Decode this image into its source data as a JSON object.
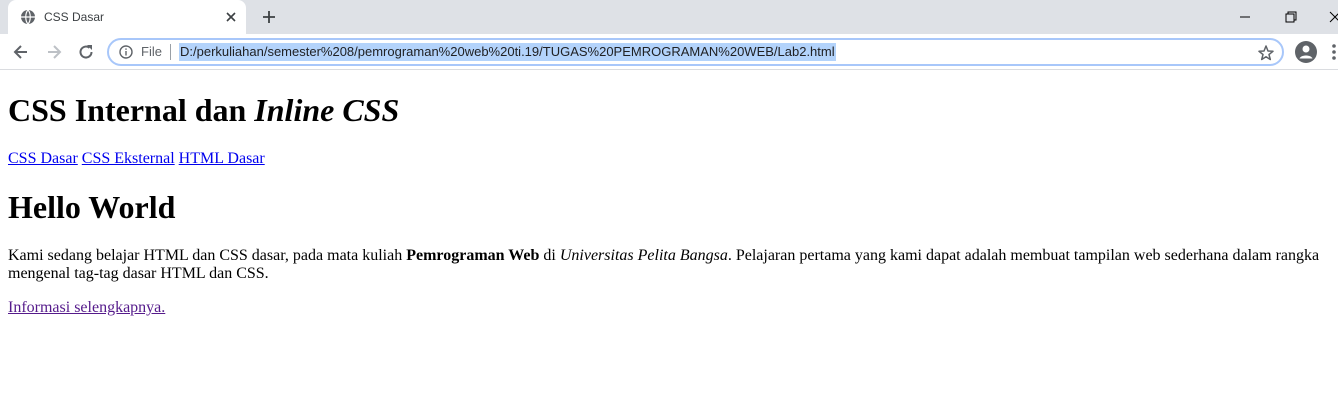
{
  "browser": {
    "tab": {
      "title": "CSS Dasar",
      "favicon": "globe-icon"
    },
    "omnibox": {
      "scheme_label": "File",
      "url": "D:/perkuliahan/semester%208/pemrograman%20web%20ti.19/TUGAS%20PEMROGRAMAN%20WEB/Lab2.html"
    },
    "icons": [
      "back-icon",
      "forward-icon",
      "reload-icon",
      "info-icon",
      "star-icon",
      "profile-icon",
      "new-tab-icon",
      "close-icon",
      "minimize-icon",
      "restore-icon",
      "menu-icon"
    ]
  },
  "page": {
    "title_plain": "CSS Internal dan ",
    "title_italic": "Inline CSS",
    "nav_links": [
      "CSS Dasar",
      "CSS Eksternal",
      "HTML Dasar"
    ],
    "heading2": "Hello World",
    "paragraph": {
      "part1": "Kami sedang belajar HTML dan CSS dasar, pada mata kuliah ",
      "bold": "Pemrograman Web",
      "part2": " di ",
      "italic": "Universitas Pelita Bangsa",
      "part3": ". Pelajaran pertama yang kami dapat adalah membuat tampilan web sederhana dalam rangka mengenal tag-tag dasar HTML dan CSS."
    },
    "more_link": "Informasi selengkapnya."
  }
}
